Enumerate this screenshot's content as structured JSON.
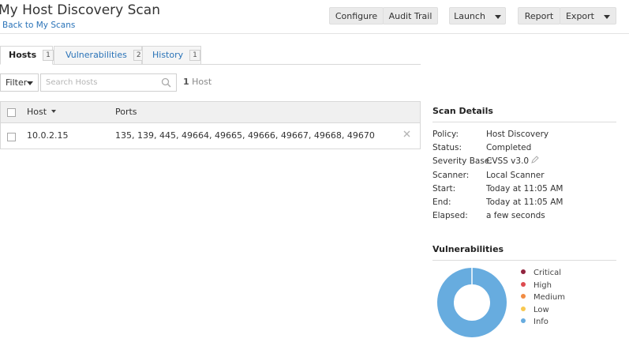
{
  "page": {
    "title": "My Host Discovery Scan",
    "back_link": "Back to My Scans"
  },
  "toolbar": {
    "configure": "Configure",
    "audit_trail": "Audit Trail",
    "launch": "Launch",
    "report": "Report",
    "export": "Export"
  },
  "tabs": [
    {
      "label": "Hosts",
      "count": "1",
      "active": true
    },
    {
      "label": "Vulnerabilities",
      "count": "2",
      "active": false
    },
    {
      "label": "History",
      "count": "1",
      "active": false
    }
  ],
  "filter": {
    "label": "Filter",
    "search_placeholder": "Search Hosts",
    "count_number": "1",
    "count_label": "Host"
  },
  "hosts_table": {
    "columns": [
      "Host",
      "Ports"
    ],
    "rows": [
      {
        "host": "10.0.2.15",
        "ports": "135, 139, 445, 49664, 49665, 49666, 49667, 49668, 49670"
      }
    ]
  },
  "scan_details": {
    "title": "Scan Details",
    "items": [
      {
        "label": "Policy:",
        "value": "Host Discovery"
      },
      {
        "label": "Status:",
        "value": "Completed"
      },
      {
        "label": "Severity Base:",
        "value": "CVSS v3.0"
      },
      {
        "label": "Scanner:",
        "value": "Local Scanner"
      },
      {
        "label": "Start:",
        "value": "Today at 11:05 AM"
      },
      {
        "label": "End:",
        "value": "Today at 11:05 AM"
      },
      {
        "label": "Elapsed:",
        "value": "a few seconds"
      }
    ]
  },
  "vulnerabilities": {
    "title": "Vulnerabilities",
    "legend": [
      {
        "label": "Critical",
        "color": "#91243e"
      },
      {
        "label": "High",
        "color": "#dd4b50"
      },
      {
        "label": "Medium",
        "color": "#f18c43"
      },
      {
        "label": "Low",
        "color": "#f8c851"
      },
      {
        "label": "Info",
        "color": "#67acdf"
      }
    ]
  },
  "chart_data": {
    "type": "pie",
    "categories": [
      "Critical",
      "High",
      "Medium",
      "Low",
      "Info"
    ],
    "values": [
      0,
      0,
      0,
      0,
      100
    ],
    "colors": [
      "#91243e",
      "#dd4b50",
      "#f18c43",
      "#f8c851",
      "#67acdf"
    ],
    "title": "Vulnerabilities",
    "donut": true,
    "legend_position": "right"
  }
}
